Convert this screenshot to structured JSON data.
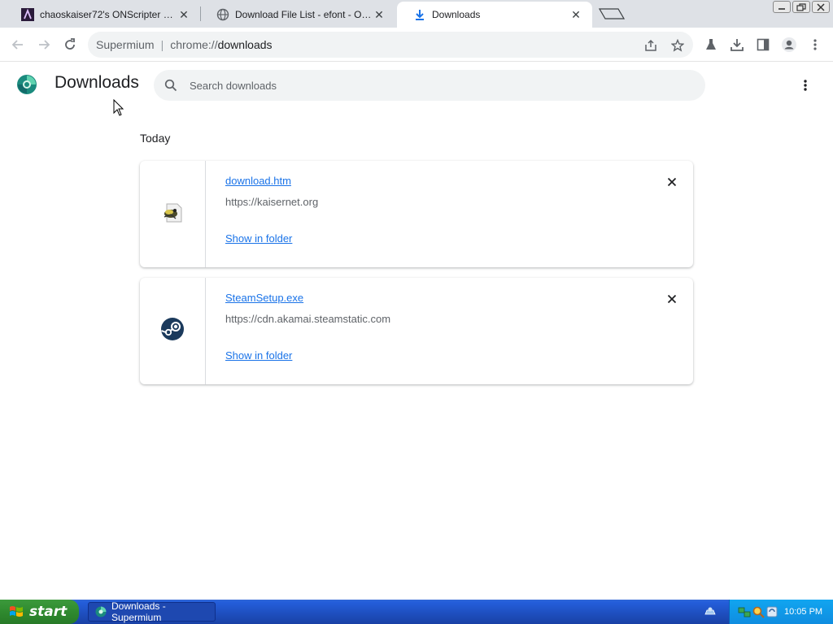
{
  "browser": {
    "tabs": [
      {
        "title": "chaoskaiser72's ONScripter Corner",
        "favicon": "site-logo-icon",
        "active": false
      },
      {
        "title": "Download File List - efont - OSDN",
        "favicon": "globe-icon",
        "active": false
      },
      {
        "title": "Downloads",
        "favicon": "download-arrow-icon",
        "active": true
      }
    ],
    "omnibox": {
      "site_label": "Supermium",
      "scheme": "chrome://",
      "path": "downloads"
    }
  },
  "page": {
    "title": "Downloads",
    "search_placeholder": "Search downloads",
    "section_label": "Today",
    "downloads": [
      {
        "filename": "download.htm",
        "url": "https://kaisernet.org",
        "action": "Show in folder",
        "icon": "html-file-icon"
      },
      {
        "filename": "SteamSetup.exe",
        "url": "https://cdn.akamai.steamstatic.com",
        "action": "Show in folder",
        "icon": "steam-icon"
      }
    ]
  },
  "taskbar": {
    "start_label": "start",
    "task_item": "Downloads - Supermium",
    "clock": "10:05 PM"
  },
  "colors": {
    "link": "#1a73e8",
    "tabstrip": "#dee1e6",
    "omnibox": "#f1f3f4",
    "xp_start_green": "#2f8a2f",
    "xp_taskbar_blue": "#245edb"
  }
}
